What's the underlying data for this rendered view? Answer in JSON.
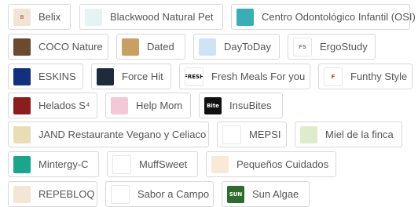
{
  "brands": [
    {
      "id": "belix",
      "label": "Belix",
      "logo_text": "B",
      "logo_bg": "#f1e3d6",
      "logo_fg": "#b98a6a"
    },
    {
      "id": "blackwood",
      "label": "Blackwood Natural Pet",
      "logo_text": "",
      "logo_bg": "#e6f3f3",
      "logo_fg": "#4fa3a6"
    },
    {
      "id": "centro",
      "label": "Centro Odontológico Infantil (OSI)",
      "logo_text": "",
      "logo_bg": "#39aeb5",
      "logo_fg": "#ffffff"
    },
    {
      "id": "coco",
      "label": "COCO Nature",
      "logo_text": "",
      "logo_bg": "#6b4a2f",
      "logo_fg": "#ffffff"
    },
    {
      "id": "dated",
      "label": "Dated",
      "logo_text": "",
      "logo_bg": "#c8a064",
      "logo_fg": "#ffffff"
    },
    {
      "id": "daytoday",
      "label": "DayToDay",
      "logo_text": "",
      "logo_bg": "#cfe3f7",
      "logo_fg": "#5a8fc8"
    },
    {
      "id": "ergostudy",
      "label": "ErgoStudy",
      "logo_text": "FS",
      "logo_bg": "#ffffff",
      "logo_fg": "#888888"
    },
    {
      "id": "eskins",
      "label": "ESKINS",
      "logo_text": "",
      "logo_bg": "#13307a",
      "logo_fg": "#ffffff"
    },
    {
      "id": "forcehit",
      "label": "Force Hit",
      "logo_text": "",
      "logo_bg": "#1f2b3d",
      "logo_fg": "#ffffff"
    },
    {
      "id": "freshmeals",
      "label": "Fresh Meals For you",
      "logo_text": "FRESH",
      "logo_bg": "#ffffff",
      "logo_fg": "#111111"
    },
    {
      "id": "funthy",
      "label": "Funthy Style",
      "logo_text": "F",
      "logo_bg": "#ffffff",
      "logo_fg": "#c0392b"
    },
    {
      "id": "helados",
      "label": "Helados S⁴",
      "logo_text": "",
      "logo_bg": "#8b1d1d",
      "logo_fg": "#ffffff"
    },
    {
      "id": "helpmom",
      "label": "Help Mom",
      "logo_text": "",
      "logo_bg": "#f3c9d8",
      "logo_fg": "#c0587a"
    },
    {
      "id": "insubites",
      "label": "InsuBites",
      "logo_text": "Bite",
      "logo_bg": "#111111",
      "logo_fg": "#ffffff"
    },
    {
      "id": "jand",
      "label": "JAND Restaurante Vegano y Celiaco",
      "logo_text": "",
      "logo_bg": "#e9ddb6",
      "logo_fg": "#8a7a3c"
    },
    {
      "id": "mepsi",
      "label": "MEPSI",
      "logo_text": "",
      "logo_bg": "#ffffff",
      "logo_fg": "#2e8b57"
    },
    {
      "id": "miel",
      "label": "Miel de la finca",
      "logo_text": "",
      "logo_bg": "#dfeccc",
      "logo_fg": "#6a8f3a"
    },
    {
      "id": "mintergy",
      "label": "Mintergy-C",
      "logo_text": "",
      "logo_bg": "#1aa58c",
      "logo_fg": "#ffffff"
    },
    {
      "id": "muffsweet",
      "label": "MuffSweet",
      "logo_text": "",
      "logo_bg": "#ffffff",
      "logo_fg": "#111111"
    },
    {
      "id": "pequenos",
      "label": "Pequeños Cuidados",
      "logo_text": "",
      "logo_bg": "#fbe9d8",
      "logo_fg": "#e0884a"
    },
    {
      "id": "repebloq",
      "label": "REPEBLOQ",
      "logo_text": "",
      "logo_bg": "#f4e6d4",
      "logo_fg": "#c07b3a"
    },
    {
      "id": "sabor",
      "label": "Sabor a Campo",
      "logo_text": "",
      "logo_bg": "#ffffff",
      "logo_fg": "#d33a3a"
    },
    {
      "id": "sunalgae",
      "label": "Sun Algae",
      "logo_text": "SUN",
      "logo_bg": "#2f6b2f",
      "logo_fg": "#ffffff"
    }
  ]
}
